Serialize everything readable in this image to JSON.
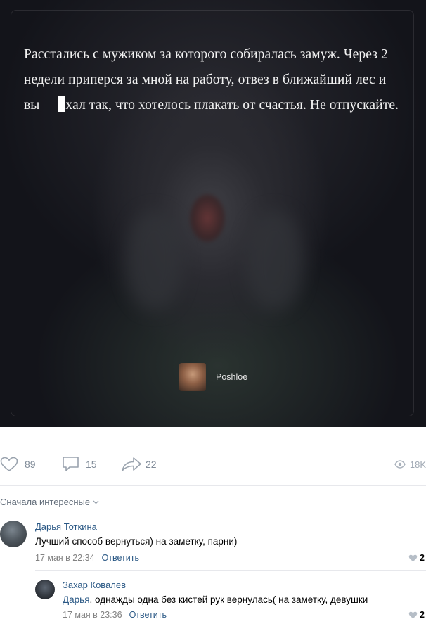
{
  "post": {
    "text_before": "Расстались с мужиком за которого собиралась замуж. Через 2 недели приперся за мной на работу, отвез в ближайший лес и вы",
    "text_after": "хал так, что хотелось плакать от счастья. Не отпускайте.",
    "source_name": "Poshloe"
  },
  "actions": {
    "likes": "89",
    "comments": "15",
    "shares": "22",
    "views": "18K"
  },
  "sort_label": "Сначала интересные",
  "comments": [
    {
      "author": "Дарья Тоткина",
      "text": "Лучший способ вернуться) на заметку, парни)",
      "date": "17 мая в 22:34",
      "reply_label": "Ответить",
      "likes": "2"
    },
    {
      "author": "Захар Ковалев",
      "reply_to": "Дарья",
      "text": ", однажды одна без кистей рук вернулась( на заметку, девушки",
      "date": "17 мая в 23:36",
      "reply_label": "Ответить",
      "likes": "2"
    }
  ]
}
